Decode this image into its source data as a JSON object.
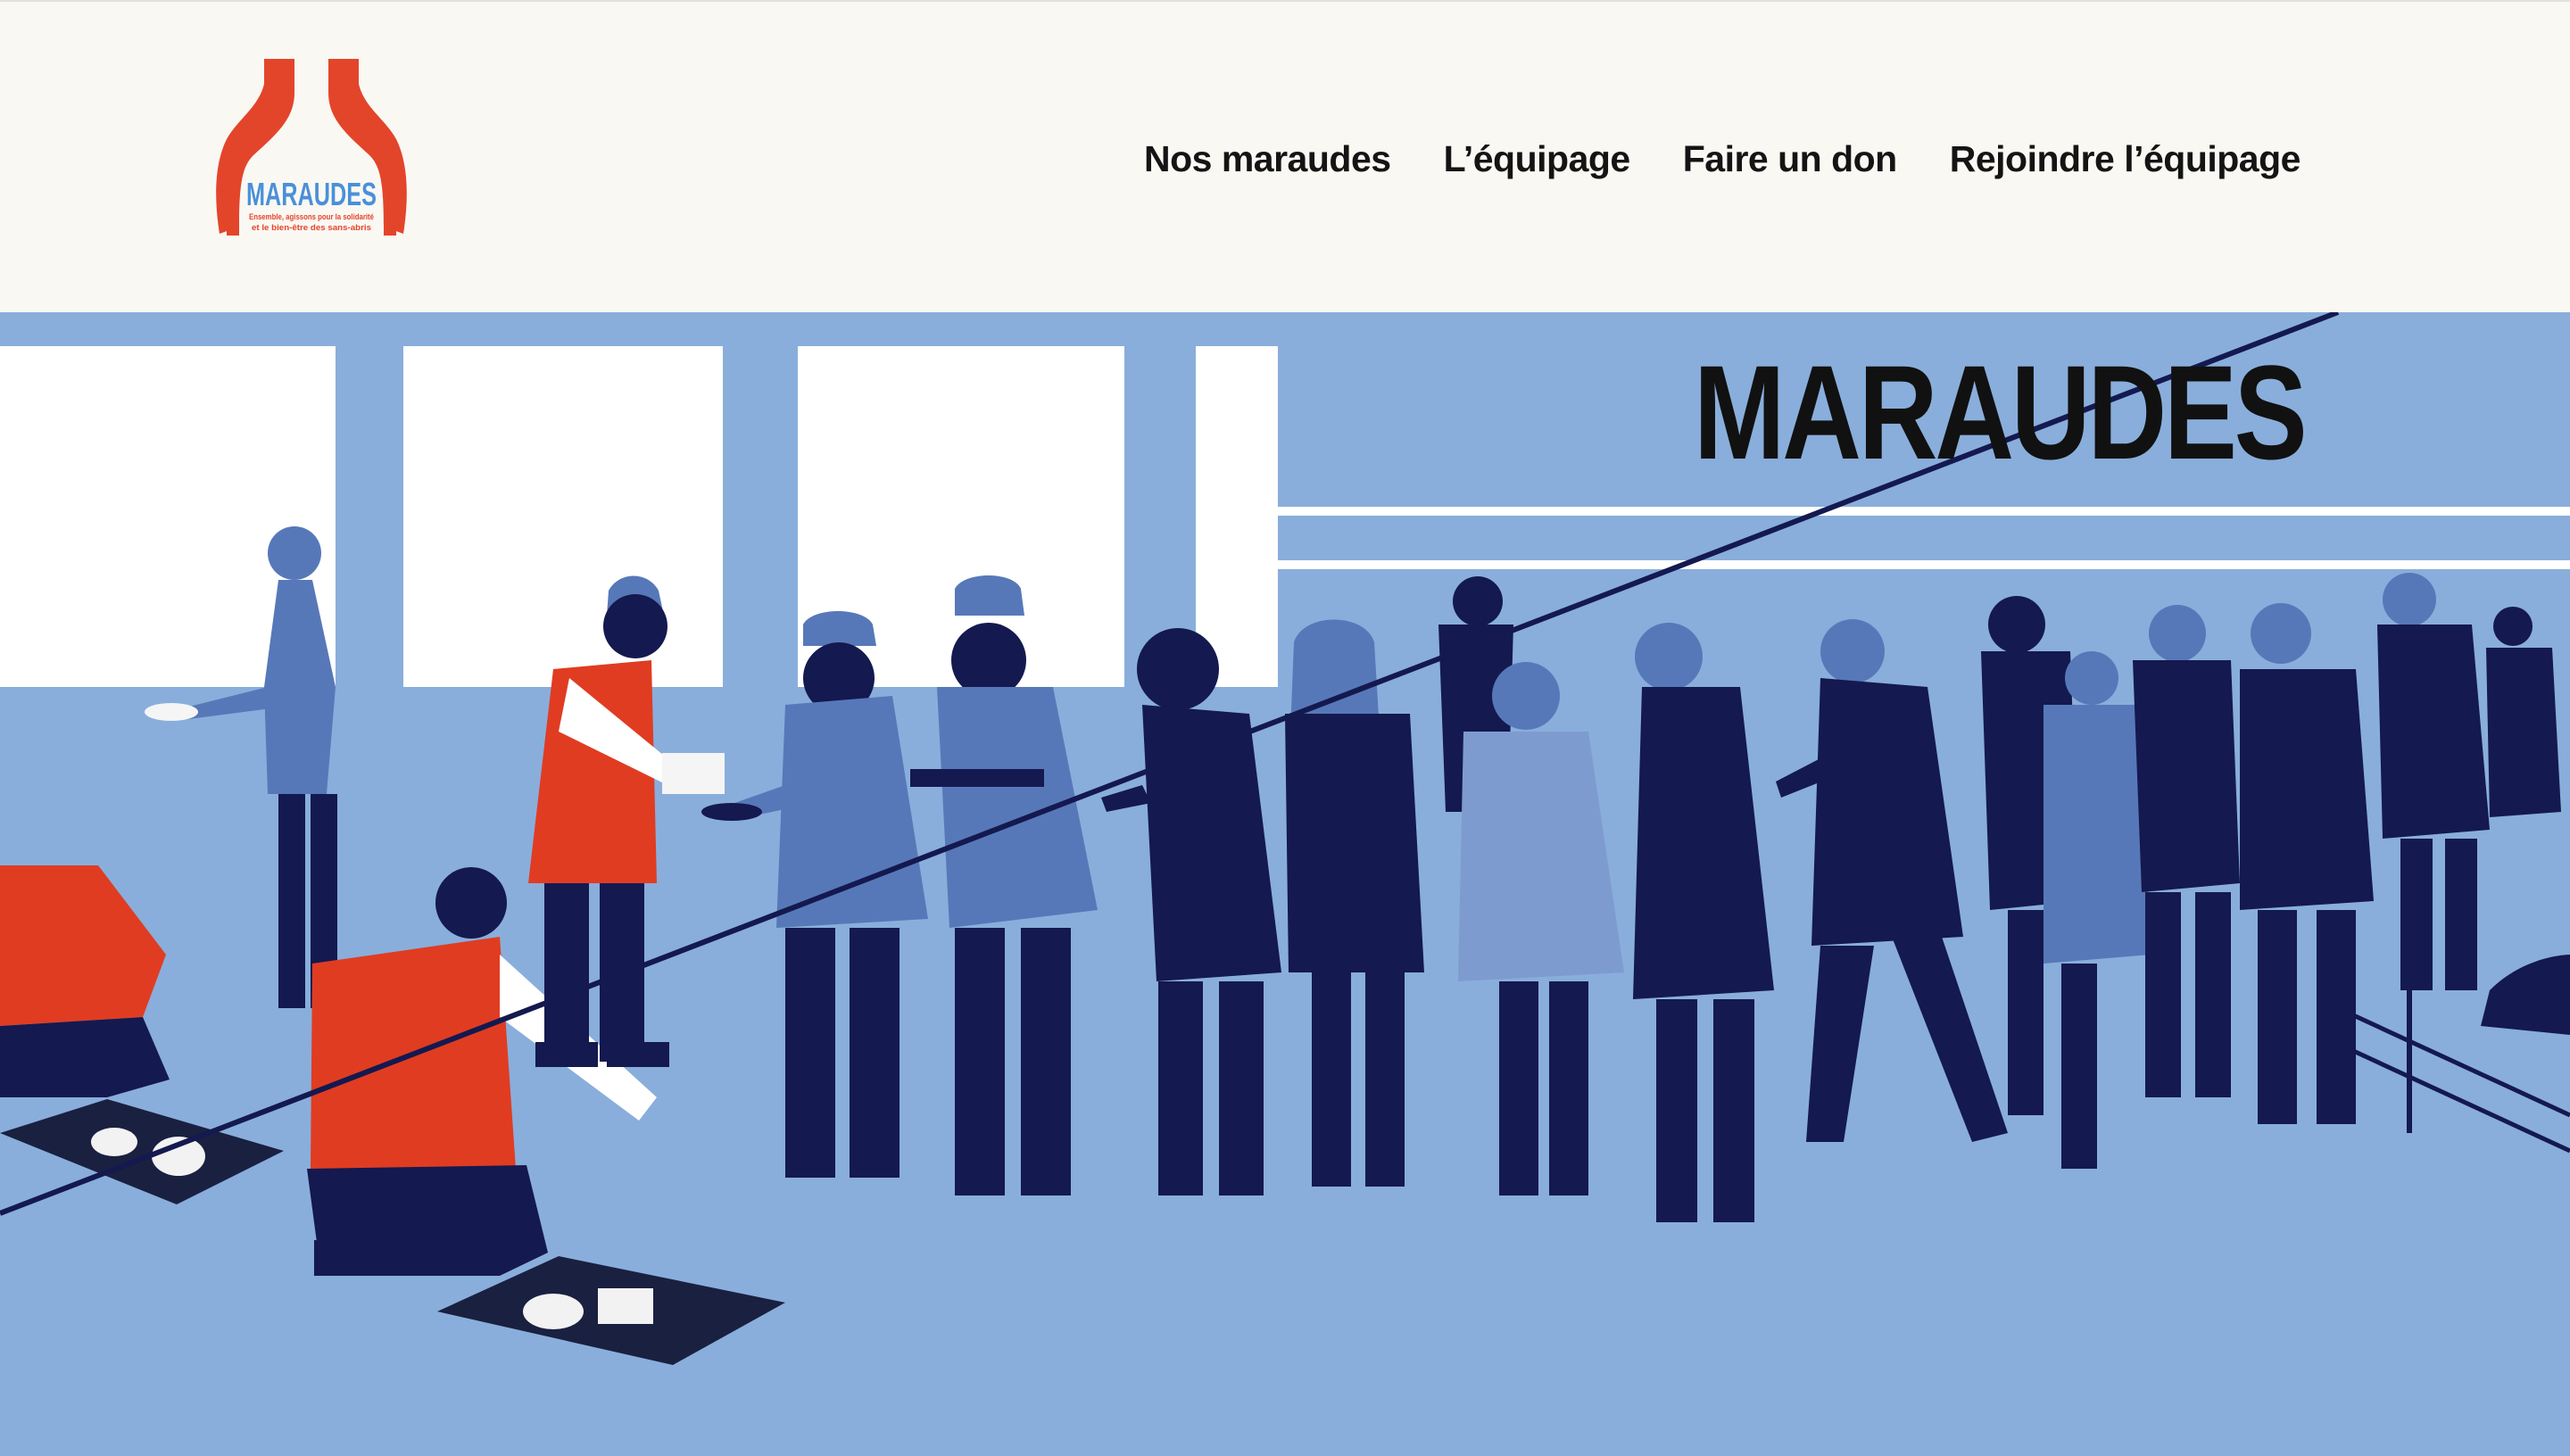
{
  "logo": {
    "wordmark": "MARAUDES",
    "tagline_line1": "Ensemble, agissons pour la solidarité",
    "tagline_line2": "et le bien-être des sans-abris",
    "colors": {
      "hands": "#e3452b",
      "wordmark": "#4a90d9"
    }
  },
  "nav": {
    "items": [
      {
        "label": "Nos maraudes"
      },
      {
        "label": "L’équipage"
      },
      {
        "label": "Faire un don"
      },
      {
        "label": "Rejoindre l’équipage"
      }
    ]
  },
  "hero": {
    "title": "MARAUDES",
    "colors": {
      "background": "#89aedb",
      "volunteer_vest": "#e03c22",
      "figures_dark": "#14194f",
      "figures_mid": "#5778b8",
      "windows": "#ffffff"
    }
  }
}
